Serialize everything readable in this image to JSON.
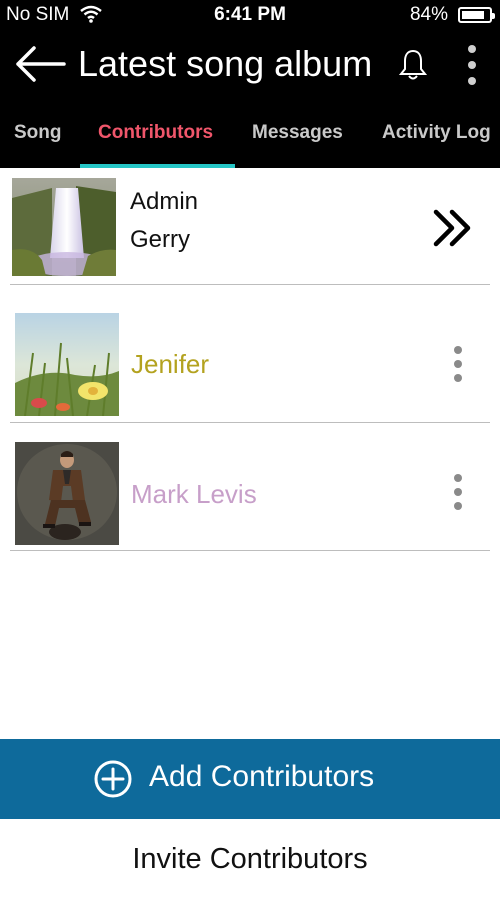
{
  "status_bar": {
    "carrier": "No SIM",
    "time": "6:41 PM",
    "battery_percent": "84%",
    "battery_level": 0.84,
    "icons": [
      "wifi-icon",
      "battery-icon"
    ]
  },
  "header": {
    "title": "Latest song album",
    "icons": [
      "back-arrow-icon",
      "bell-icon",
      "more-vertical-icon"
    ]
  },
  "tabs": [
    {
      "label": "Song",
      "active": false
    },
    {
      "label": "Contributors",
      "active": true
    },
    {
      "label": "Messages",
      "active": false
    },
    {
      "label": "Activity Log",
      "active": false
    }
  ],
  "colors": {
    "active_tab": "#f0566b",
    "tab_indicator": "#26c6c6",
    "add_button": "#0e6a9b",
    "contributor_jenifer": "#b3a21f",
    "contributor_mark": "#c79fc9"
  },
  "contributors": [
    {
      "role": "Admin",
      "name": "Gerry",
      "thumb": "waterfall-photo",
      "action_icon": "double-chevron-right-icon"
    },
    {
      "name": "Jenifer",
      "thumb": "flowers-photo",
      "action_icon": "more-vertical-icon"
    },
    {
      "name": "Mark Levis",
      "thumb": "man-portrait-photo",
      "action_icon": "more-vertical-icon"
    }
  ],
  "actions": {
    "add_label": "Add Contributors",
    "add_icon": "plus-circle-icon",
    "invite_label": "Invite Contributors"
  }
}
